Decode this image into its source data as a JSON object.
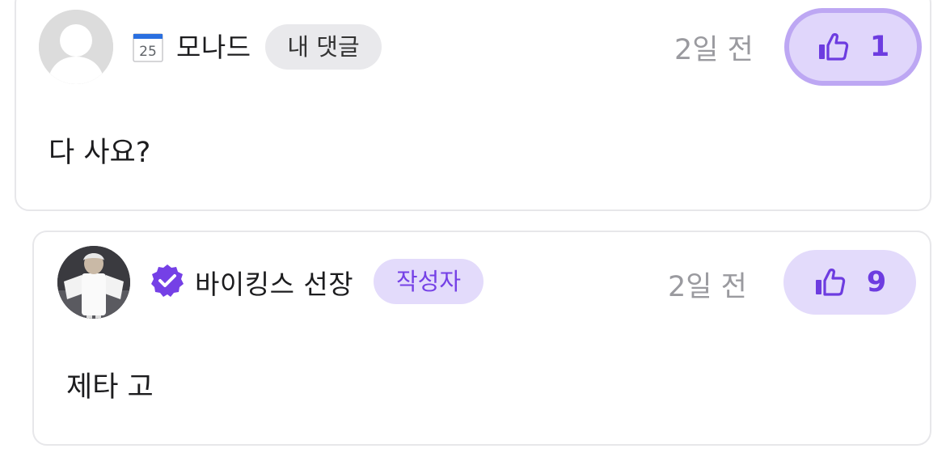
{
  "comments": [
    {
      "author": "모나드",
      "tag": "내 댓글",
      "time": "2일 전",
      "likes": "1",
      "text": "다 사요?",
      "badge_icon": "calendar-icon",
      "badge_day": "25",
      "like_active": true
    },
    {
      "author": "바이킹스 선장",
      "tag": "작성자",
      "time": "2일 전",
      "likes": "9",
      "text": "제타 고",
      "badge_icon": "verified-icon",
      "like_active": false
    }
  ],
  "colors": {
    "accent": "#6d3ce0",
    "like_bg": "#e3dbfb",
    "tag_author_bg": "#e3dbfb",
    "tag_mine_bg": "#e9e9ec",
    "time": "#9a9a9f",
    "border": "#e7e7ea"
  }
}
